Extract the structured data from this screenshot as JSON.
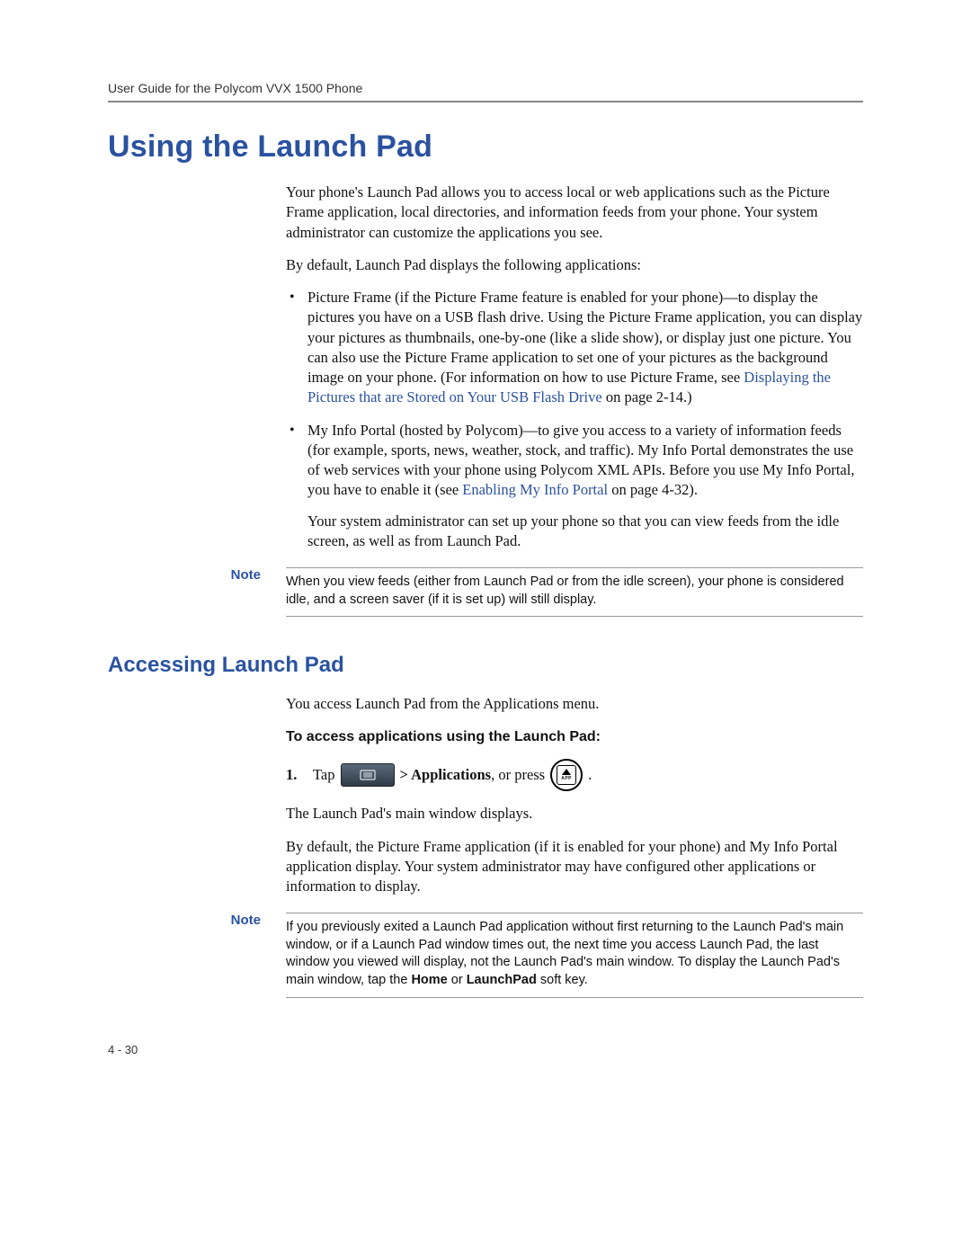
{
  "header": {
    "running_head": "User Guide for the Polycom VVX 1500 Phone"
  },
  "section": {
    "title": "Using the Launch Pad",
    "intro_p1": "Your phone's Launch Pad allows you to access local or web applications such as the Picture Frame application, local directories, and information feeds from your phone. Your system administrator can customize the applications you see.",
    "intro_p2": "By default, Launch Pad displays the following applications:",
    "bullet1_a": "Picture Frame (if the Picture Frame feature is enabled for your phone)—to display the pictures you have on a USB flash drive. Using the Picture Frame application, you can display your pictures as thumbnails, one-by-one (like a slide show), or display just one picture. You can also use the Picture Frame application to set one of your pictures as the background image on your phone. (For information on how to use Picture Frame, see ",
    "bullet1_link": "Displaying the Pictures that are Stored on Your USB Flash Drive",
    "bullet1_b": " on page 2-14.)",
    "bullet2_a": "My Info Portal (hosted by Polycom)—to give you access to a variety of information feeds (for example, sports, news, weather, stock, and traffic). My Info Portal demonstrates the use of web services with your phone using Polycom XML APIs. Before you use My Info Portal, you have to enable it (see ",
    "bullet2_link": "Enabling My Info Portal",
    "bullet2_b": " on page 4-32).",
    "bullet2_p2": "Your system administrator can set up your phone so that you can view feeds from the idle screen, as well as from Launch Pad."
  },
  "notes": {
    "label": "Note",
    "note1": "When you view feeds (either from Launch Pad or from the idle screen), your phone is considered idle, and a screen saver (if it is set up) will still display.",
    "note2_a": "If you previously exited a Launch Pad application without first returning to the Launch Pad's main window, or if a Launch Pad window times out, the next time you access Launch Pad, the last window you viewed will display, not the Launch Pad's main window. To display the Launch Pad's main window, tap the ",
    "note2_home": "Home",
    "note2_b": " or ",
    "note2_lp": "LaunchPad",
    "note2_c": " soft key."
  },
  "subsection": {
    "title": "Accessing Launch Pad",
    "p1": "You access Launch Pad from the Applications menu.",
    "task_head": "To access applications using the Launch Pad:",
    "step1_num": "1.",
    "step1_a": "Tap",
    "step1_b": " > ",
    "step1_apps": "Applications",
    "step1_c": ", or press",
    "step1_d": ".",
    "step_p2": "The Launch Pad's main window displays.",
    "step_p3": "By default, the Picture Frame application (if it is enabled for your phone) and My Info Portal application display. Your system administrator may have configured other applications or information to display."
  },
  "footer": {
    "page_num": "4 - 30"
  }
}
